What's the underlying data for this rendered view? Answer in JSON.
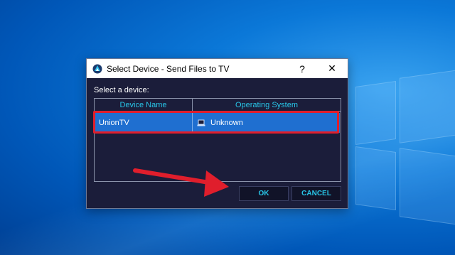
{
  "dialog": {
    "title": "Select Device - Send Files to TV",
    "help_label": "?",
    "close_label": "✕",
    "prompt": "Select a device:"
  },
  "table": {
    "columns": [
      "Device Name",
      "Operating System"
    ],
    "rows": [
      {
        "device_name": "UnionTV",
        "os": "Unknown",
        "os_icon": "laptop-icon"
      }
    ]
  },
  "buttons": {
    "ok_label": "OK",
    "cancel_label": "CANCEL"
  },
  "colors": {
    "accent": "#28c6e8",
    "selection": "#1f6fd0",
    "highlight": "#e01e2c",
    "dialog_bg": "#1b1d3a"
  }
}
